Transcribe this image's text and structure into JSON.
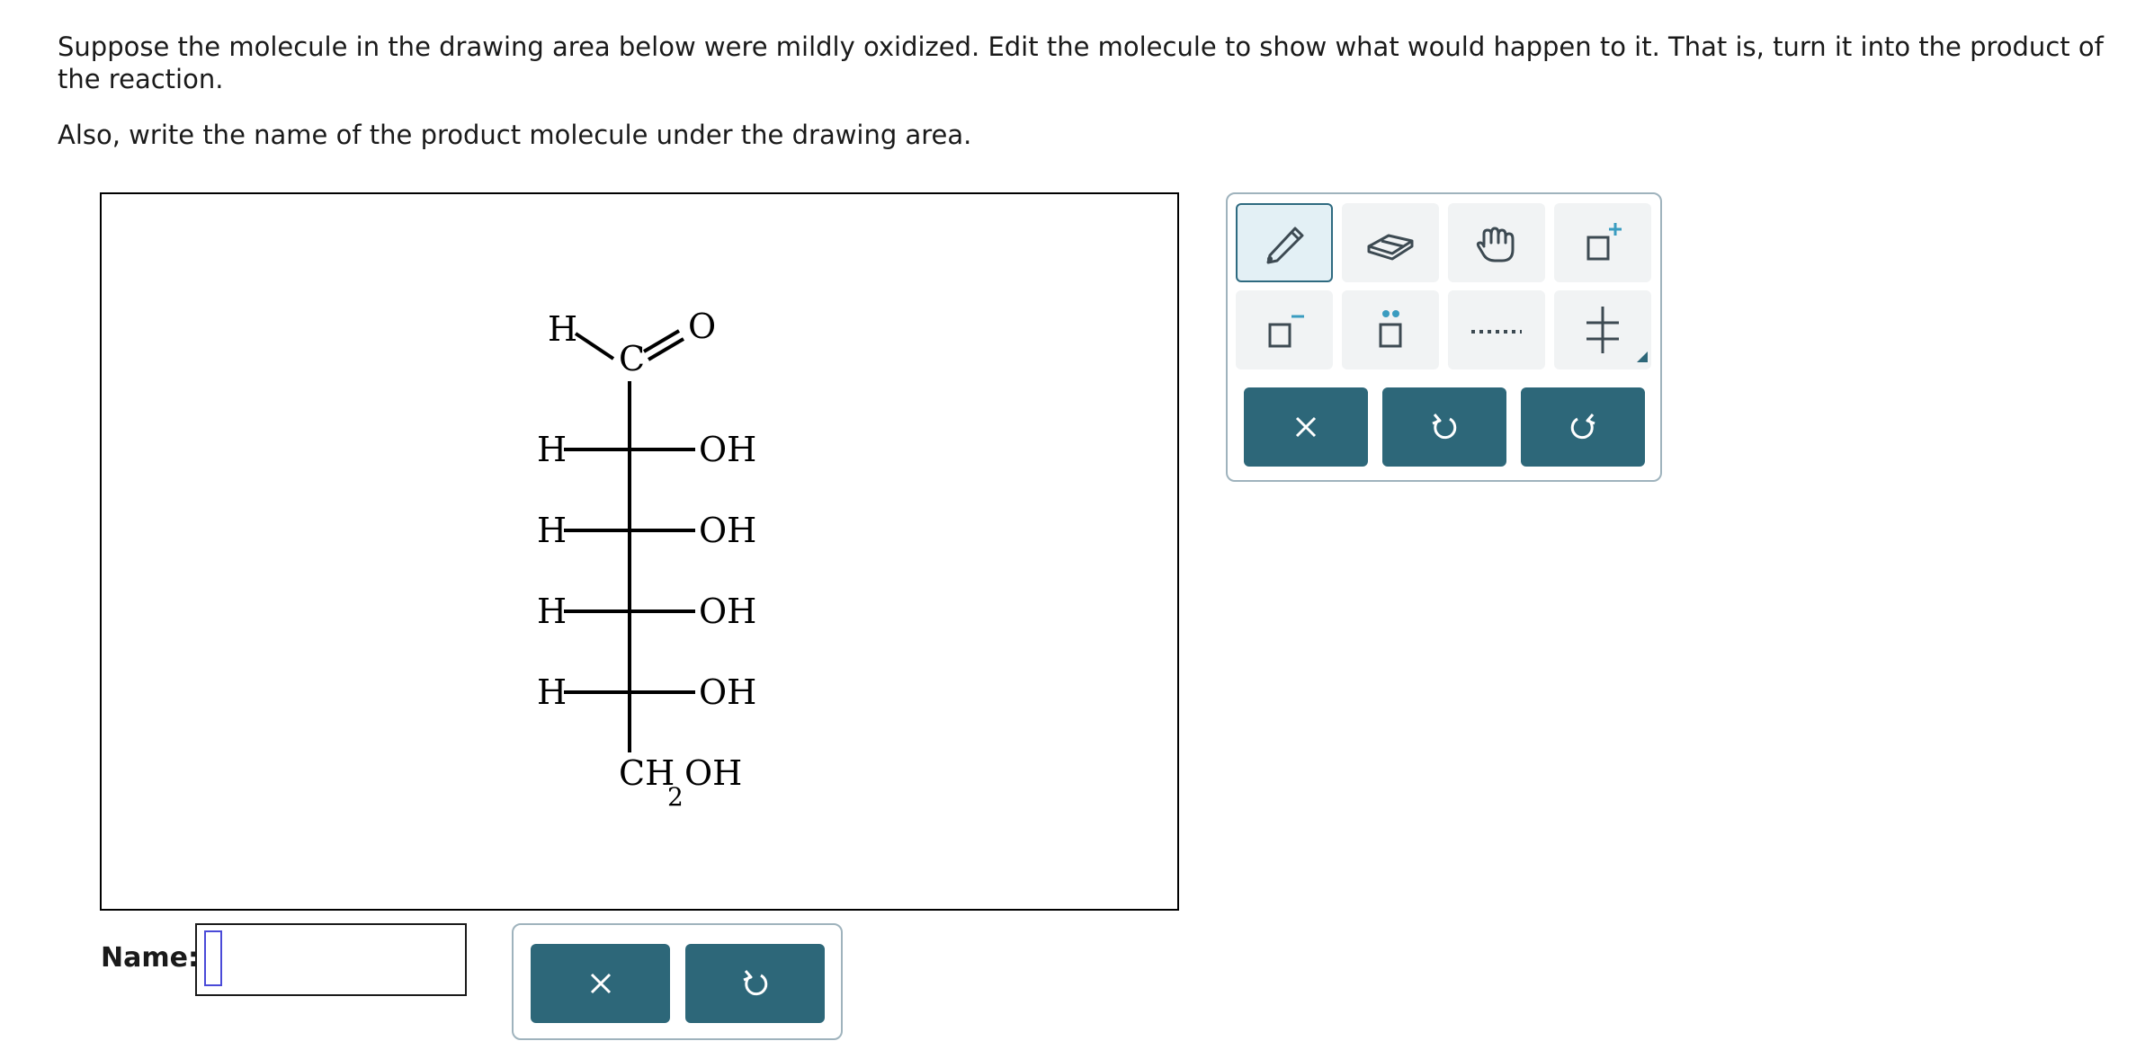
{
  "question": {
    "line1": "Suppose the molecule in the drawing area below were mildly oxidized. Edit the molecule to show what would happen to it. That is, turn it into the product of the reaction.",
    "line2": "Also, write the name of the product molecule under the drawing area."
  },
  "molecule": {
    "aldehyde_h": "H",
    "carbonyl_c": "C",
    "carbonyl_o": "O",
    "rows": [
      {
        "left": "H",
        "right": "OH"
      },
      {
        "left": "H",
        "right": "OH"
      },
      {
        "left": "H",
        "right": "OH"
      },
      {
        "left": "H",
        "right": "OH"
      }
    ],
    "bottom_group": {
      "main": "CH",
      "sub": "2",
      "tail": "OH"
    }
  },
  "toolbox": {
    "tools": [
      "pencil-icon",
      "eraser-icon",
      "hand-icon",
      "add-charge-icon",
      "remove-charge-icon",
      "lone-pair-icon",
      "dashed-bond-icon",
      "templates-icon"
    ],
    "actions": [
      "clear-icon",
      "undo-icon",
      "redo-icon"
    ],
    "accent_color": "#2d6779",
    "active_tool": "pencil-icon"
  },
  "name_field": {
    "label": "Name:",
    "value": ""
  },
  "name_actions": [
    "clear-icon",
    "undo-icon"
  ]
}
